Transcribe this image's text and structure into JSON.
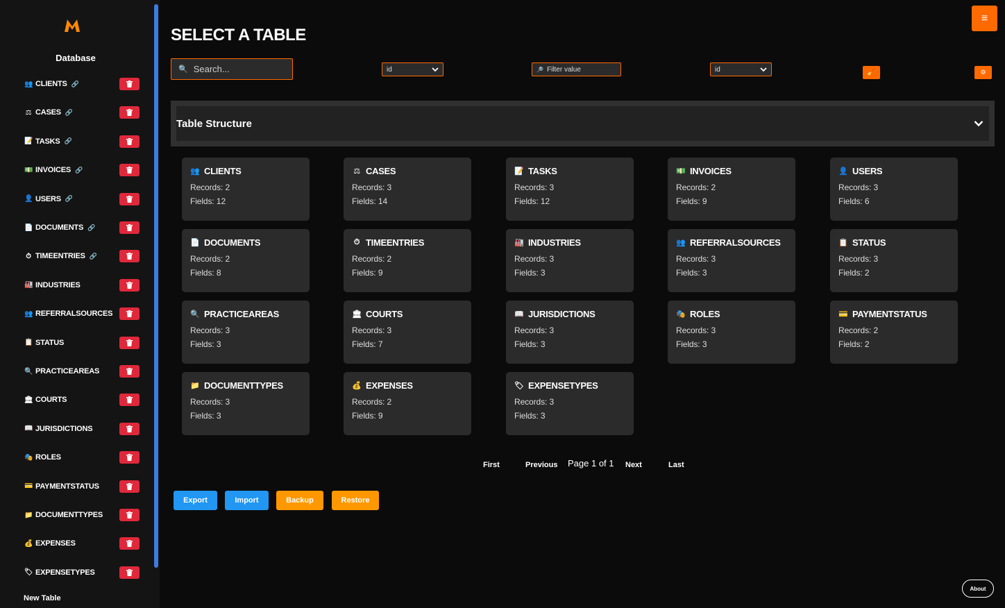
{
  "app": {
    "sidebar_title": "Database",
    "page_title": "SELECT A TABLE",
    "new_table_label": "New Table",
    "accent_color": "#ff6a00",
    "delete_color": "#e0283b"
  },
  "sidebar": {
    "items": [
      {
        "label": "CLIENTS",
        "icon": "👥",
        "linked": true
      },
      {
        "label": "CASES",
        "icon": "⚖",
        "linked": true
      },
      {
        "label": "TASKS",
        "icon": "📝",
        "linked": true
      },
      {
        "label": "INVOICES",
        "icon": "💵",
        "linked": true
      },
      {
        "label": "USERS",
        "icon": "👤",
        "linked": true
      },
      {
        "label": "DOCUMENTS",
        "icon": "📄",
        "linked": true
      },
      {
        "label": "TIMEENTRIES",
        "icon": "⏱",
        "linked": true
      },
      {
        "label": "INDUSTRIES",
        "icon": "🏭",
        "linked": false
      },
      {
        "label": "REFERRALSOURCES",
        "icon": "👥",
        "linked": false
      },
      {
        "label": "STATUS",
        "icon": "📋",
        "linked": false
      },
      {
        "label": "PRACTICEAREAS",
        "icon": "🔍",
        "linked": false
      },
      {
        "label": "COURTS",
        "icon": "🏛",
        "linked": false
      },
      {
        "label": "JURISDICTIONS",
        "icon": "📖",
        "linked": false
      },
      {
        "label": "ROLES",
        "icon": "🎭",
        "linked": false
      },
      {
        "label": "PAYMENTSTATUS",
        "icon": "💳",
        "linked": false
      },
      {
        "label": "DOCUMENTTYPES",
        "icon": "📁",
        "linked": false
      },
      {
        "label": "EXPENSES",
        "icon": "💰",
        "linked": false
      },
      {
        "label": "EXPENSETYPES",
        "icon": "🏷",
        "linked": false
      }
    ]
  },
  "toolbar": {
    "search_placeholder": "Search...",
    "sort_select_value": "id",
    "filter_placeholder": "Filter value",
    "filter_field_value": "id"
  },
  "structure": {
    "title": "Table Structure"
  },
  "cards": [
    {
      "name": "CLIENTS",
      "icon": "👥",
      "records": "Records: 2",
      "fields": "Fields: 12"
    },
    {
      "name": "CASES",
      "icon": "⚖",
      "records": "Records: 3",
      "fields": "Fields: 14"
    },
    {
      "name": "TASKS",
      "icon": "📝",
      "records": "Records: 3",
      "fields": "Fields: 12"
    },
    {
      "name": "INVOICES",
      "icon": "💵",
      "records": "Records: 2",
      "fields": "Fields: 9"
    },
    {
      "name": "USERS",
      "icon": "👤",
      "records": "Records: 3",
      "fields": "Fields: 6"
    },
    {
      "name": "DOCUMENTS",
      "icon": "📄",
      "records": "Records: 2",
      "fields": "Fields: 8"
    },
    {
      "name": "TIMEENTRIES",
      "icon": "⏱",
      "records": "Records: 2",
      "fields": "Fields: 9"
    },
    {
      "name": "INDUSTRIES",
      "icon": "🏭",
      "records": "Records: 3",
      "fields": "Fields: 3"
    },
    {
      "name": "REFERRALSOURCES",
      "icon": "👥",
      "records": "Records: 3",
      "fields": "Fields: 3"
    },
    {
      "name": "STATUS",
      "icon": "📋",
      "records": "Records: 3",
      "fields": "Fields: 2"
    },
    {
      "name": "PRACTICEAREAS",
      "icon": "🔍",
      "records": "Records: 3",
      "fields": "Fields: 3"
    },
    {
      "name": "COURTS",
      "icon": "🏛",
      "records": "Records: 3",
      "fields": "Fields: 7"
    },
    {
      "name": "JURISDICTIONS",
      "icon": "📖",
      "records": "Records: 3",
      "fields": "Fields: 3"
    },
    {
      "name": "ROLES",
      "icon": "🎭",
      "records": "Records: 3",
      "fields": "Fields: 3"
    },
    {
      "name": "PAYMENTSTATUS",
      "icon": "💳",
      "records": "Records: 2",
      "fields": "Fields: 2"
    },
    {
      "name": "DOCUMENTTYPES",
      "icon": "📁",
      "records": "Records: 3",
      "fields": "Fields: 3"
    },
    {
      "name": "EXPENSES",
      "icon": "💰",
      "records": "Records: 2",
      "fields": "Fields: 9"
    },
    {
      "name": "EXPENSETYPES",
      "icon": "🏷",
      "records": "Records: 3",
      "fields": "Fields: 3"
    }
  ],
  "pagination": {
    "first": "First",
    "previous": "Previous",
    "info": "Page 1 of 1",
    "next": "Next",
    "last": "Last"
  },
  "actions": [
    {
      "label": "Export",
      "color": "#2196f3"
    },
    {
      "label": "Import",
      "color": "#2196f3"
    },
    {
      "label": "Backup",
      "color": "#ff9800"
    },
    {
      "label": "Restore",
      "color": "#ff9800"
    }
  ],
  "about_label": "About"
}
